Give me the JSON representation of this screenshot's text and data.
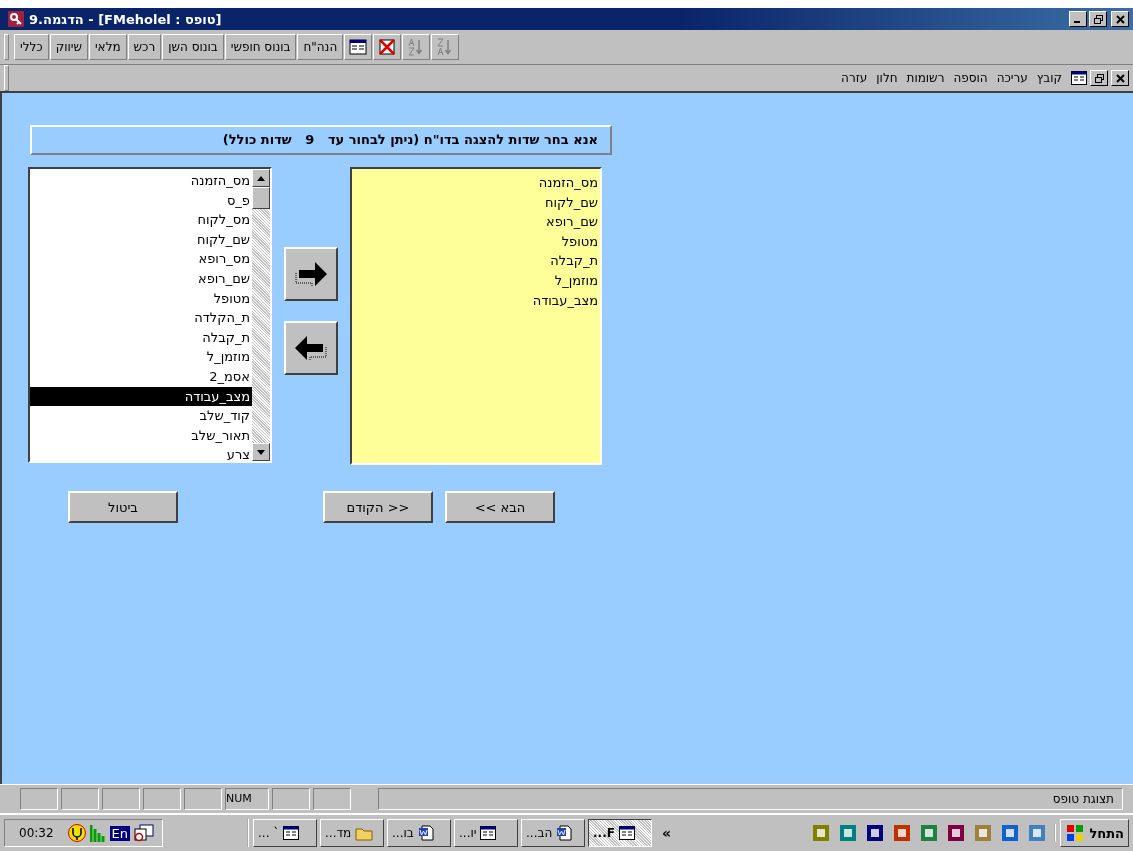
{
  "window": {
    "title": "9.הדגמה - [FMeholel : טופס]"
  },
  "toolbar": {
    "buttons": [
      "הנה\"ח",
      "בונוס חופשי",
      "בונוס השן",
      "רכש",
      "מלאי",
      "שיווק",
      "כללי"
    ]
  },
  "menu": [
    "קובץ",
    "עריכה",
    "הוספה",
    "רשומות",
    "חלון",
    "עזרה"
  ],
  "form": {
    "heading": "אנא בחר שדות להצגה בדו\"ח (ניתן לבחור עד   9   שדות כולל)",
    "available": [
      {
        "label": "מס_הזמנה",
        "selected": false
      },
      {
        "label": "פ_ס",
        "selected": false
      },
      {
        "label": "מס_לקוח",
        "selected": false
      },
      {
        "label": "שם_לקוח",
        "selected": false
      },
      {
        "label": "מס_רופא",
        "selected": false
      },
      {
        "label": "שם_רופא",
        "selected": false
      },
      {
        "label": "מטופל",
        "selected": false
      },
      {
        "label": "ת_הקלדה",
        "selected": false
      },
      {
        "label": "ת_קבלה",
        "selected": false
      },
      {
        "label": "מוזמן_ל",
        "selected": false
      },
      {
        "label": "אסמ_2",
        "selected": false
      },
      {
        "label": "מצב_עבודה",
        "selected": true
      },
      {
        "label": "קוד_שלב",
        "selected": false
      },
      {
        "label": "תאור_שלב",
        "selected": false
      },
      {
        "label": "צרע",
        "selected": false
      }
    ],
    "chosen": [
      "מס_הזמנה",
      "שם_לקוח",
      "שם_רופא",
      "מטופל",
      "ת_קבלה",
      "מוזמן_ל",
      "מצב_עבודה"
    ],
    "cancel": "ביטול",
    "previous": "הקודם >>",
    "next": "<< הבא"
  },
  "status_bar": {
    "mode": "תצוגת טופס",
    "indicator": "NUM"
  },
  "taskbar": {
    "start": "התחל",
    "tasks": [
      {
        "label": "F...",
        "kind": "form",
        "selected": true
      },
      {
        "label": "הב...",
        "kind": "word",
        "selected": false
      },
      {
        "label": "יו...",
        "kind": "form",
        "selected": false
      },
      {
        "label": "בו...",
        "kind": "word",
        "selected": false
      },
      {
        "label": "מד...",
        "kind": "folder",
        "selected": false
      },
      {
        "label": "` ...",
        "kind": "form",
        "selected": false
      }
    ],
    "chevron": "«",
    "language": "En",
    "clock": "00:32"
  }
}
